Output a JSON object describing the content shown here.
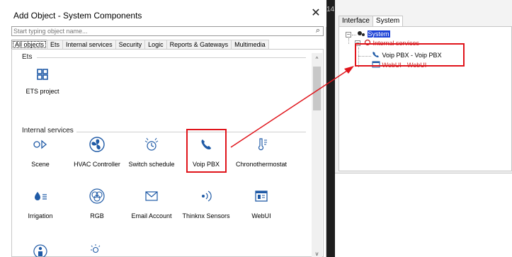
{
  "dialog": {
    "title": "Add Object - System Components",
    "close_glyph": "✕",
    "search_placeholder": "Start typing object name...",
    "tabs": [
      {
        "label": "All objects"
      },
      {
        "label": "Ets"
      },
      {
        "label": "Internal services"
      },
      {
        "label": "Security"
      },
      {
        "label": "Logic"
      },
      {
        "label": "Reports & Gateways"
      },
      {
        "label": "Multimedia"
      }
    ],
    "groups": {
      "ets": {
        "label": "Ets",
        "items": [
          {
            "label": "ETS project",
            "icon": "ets-grid-icon"
          }
        ]
      },
      "internal": {
        "label": "Internal services",
        "items": [
          {
            "label": "Scene",
            "icon": "scene-icon"
          },
          {
            "label": "HVAC Controller",
            "icon": "fan-icon"
          },
          {
            "label": "Switch schedule",
            "icon": "clock-icon"
          },
          {
            "label": "Voip PBX",
            "icon": "phone-icon"
          },
          {
            "label": "Chronothermostat",
            "icon": "thermometer-icon"
          },
          {
            "label": "Irrigation",
            "icon": "drop-icon"
          },
          {
            "label": "RGB",
            "icon": "rgb-icon"
          },
          {
            "label": "Email Account",
            "icon": "envelope-icon"
          },
          {
            "label": "Thinknx Sensors",
            "icon": "sensor-icon"
          },
          {
            "label": "WebUI",
            "icon": "webui-icon"
          }
        ]
      }
    },
    "scroll": {
      "up": "^",
      "down": "v"
    }
  },
  "time_fragment": "14:",
  "right_panel": {
    "tabs": [
      {
        "label": "Interface"
      },
      {
        "label": "System"
      }
    ],
    "tree": {
      "root": {
        "label": "System",
        "expander": "−"
      },
      "internal": {
        "label": "Internal services",
        "expander": "−"
      },
      "children": [
        {
          "label": "Voip PBX - Voip PBX",
          "icon": "phone-icon"
        },
        {
          "label": "WebUI - WebUI",
          "icon": "webui-icon"
        }
      ]
    }
  },
  "colors": {
    "accent_blue": "#1f5aa6",
    "highlight_red": "#e0141b",
    "selection": "#1d43d6"
  }
}
